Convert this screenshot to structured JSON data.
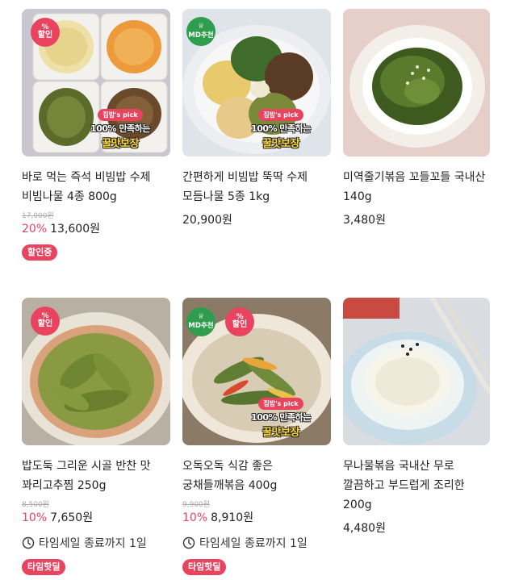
{
  "products": [
    {
      "title": "바로 먹는 즉석 비빔밥 수제 비빔나물 4종 800g",
      "original_price": "17,000원",
      "discount_rate": "20%",
      "price": "13,600원",
      "badges": [
        "sale"
      ],
      "sale_badge": {
        "pct": "%",
        "text": "할인"
      },
      "pick": {
        "tag": "집밥's pick",
        "line1": "100% 만족하는",
        "line2": "꿀맛보장"
      },
      "chip": "할인중"
    },
    {
      "title": "간편하게 비빔밥 뚝딱 수제 모듬나물 5종 1kg",
      "price": "20,900원",
      "md_badge": {
        "text": "MD추천"
      },
      "pick": {
        "tag": "집밥's pick",
        "line1": "100% 만족하는",
        "line2": "꿀맛보장"
      }
    },
    {
      "title": "미역줄기볶음 꼬들꼬들 국내산 140g",
      "price": "3,480원"
    },
    {
      "title": "밥도둑 그리운 시골 반찬 맛 꽈리고추찜 250g",
      "original_price": "8,500원",
      "discount_rate": "10%",
      "price": "7,650원",
      "sale_badge": {
        "pct": "%",
        "text": "할인"
      },
      "timer": "타임세일 종료까지 1일",
      "chip": "타임핫딜"
    },
    {
      "title": "오독오독 식감 좋은 궁채들깨볶음 400g",
      "original_price": "9,900원",
      "discount_rate": "10%",
      "price": "8,910원",
      "md_badge": {
        "text": "MD추천"
      },
      "sale_badge": {
        "pct": "%",
        "text": "할인"
      },
      "pick": {
        "tag": "집밥's pick",
        "line1": "100% 만족하는",
        "line2": "꿀맛보장"
      },
      "timer": "타임세일 종료까지 1일",
      "chip": "타임핫딜"
    },
    {
      "title": "무나물볶음 국내산 무로 깔끔하고 부드럽게 조리한 200g",
      "price": "4,480원"
    }
  ],
  "colors": {
    "accent": "#e8445f",
    "md_green": "#2f9d4e",
    "pick_yellow": "#ffd83a"
  },
  "icons": {
    "timer": "clock-icon",
    "md": "chef-hat-icon"
  }
}
